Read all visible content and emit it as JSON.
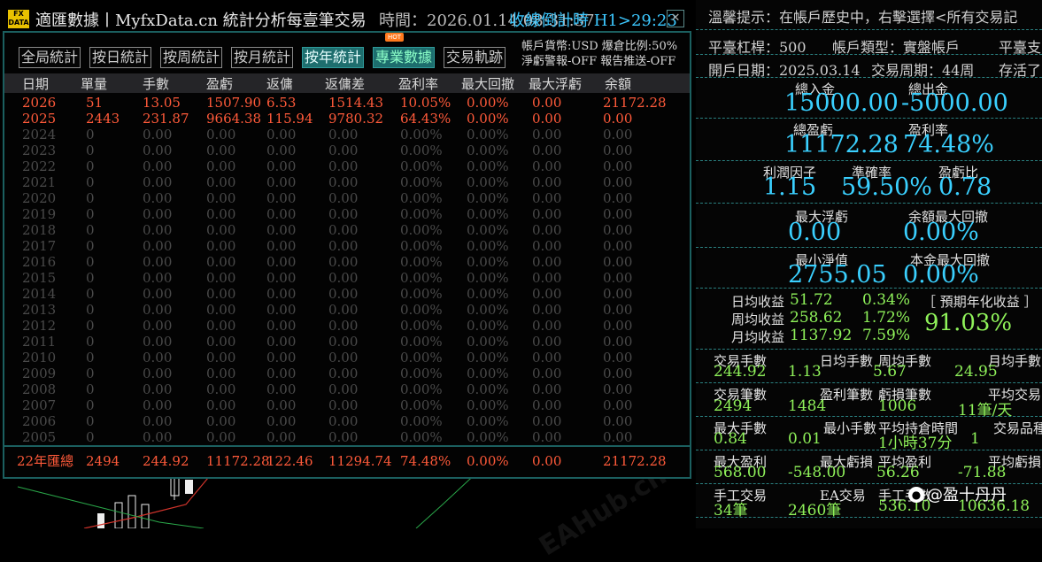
{
  "title_bar": {
    "logo_top": "FX",
    "logo_bottom": "DATA",
    "app_title": "適匯數據丨MyfxData.cn  統計分析每壹筆交易",
    "time_label": "時間：2026.01.14 08:31:37",
    "countdown_label": "收線倒計時  H1>29:23",
    "close_glyph": "✕"
  },
  "tabs": [
    {
      "label": "全局統計"
    },
    {
      "label": "按日統計"
    },
    {
      "label": "按周統計"
    },
    {
      "label": "按月統計"
    },
    {
      "label": "按年統計"
    },
    {
      "label": "專業數據"
    },
    {
      "label": "交易軌跡"
    }
  ],
  "hot_badge": "HOT",
  "account_info": {
    "line1": "帳戶貨幣:USD 爆倉比例:50%",
    "line2": "淨虧警報-OFF 報告推送-OFF"
  },
  "columns": [
    "日期",
    "單量",
    "手數",
    "盈虧",
    "返傭",
    "返傭差",
    "盈利率",
    "最大回撤",
    "最大浮虧",
    "余額"
  ],
  "rows": [
    [
      "2026",
      "51",
      "13.05",
      "1507.90",
      "6.53",
      "1514.43",
      "10.05%",
      "0.00%",
      "0.00",
      "21172.28"
    ],
    [
      "2025",
      "2443",
      "231.87",
      "9664.38",
      "115.94",
      "9780.32",
      "64.43%",
      "0.00%",
      "0.00",
      "0.00"
    ],
    [
      "2024",
      "0",
      "0.00",
      "0.00",
      "0.00",
      "0.00",
      "0.00%",
      "0.00%",
      "0.00",
      "0.00"
    ],
    [
      "2023",
      "0",
      "0.00",
      "0.00",
      "0.00",
      "0.00",
      "0.00%",
      "0.00%",
      "0.00",
      "0.00"
    ],
    [
      "2022",
      "0",
      "0.00",
      "0.00",
      "0.00",
      "0.00",
      "0.00%",
      "0.00%",
      "0.00",
      "0.00"
    ],
    [
      "2021",
      "0",
      "0.00",
      "0.00",
      "0.00",
      "0.00",
      "0.00%",
      "0.00%",
      "0.00",
      "0.00"
    ],
    [
      "2020",
      "0",
      "0.00",
      "0.00",
      "0.00",
      "0.00",
      "0.00%",
      "0.00%",
      "0.00",
      "0.00"
    ],
    [
      "2019",
      "0",
      "0.00",
      "0.00",
      "0.00",
      "0.00",
      "0.00%",
      "0.00%",
      "0.00",
      "0.00"
    ],
    [
      "2018",
      "0",
      "0.00",
      "0.00",
      "0.00",
      "0.00",
      "0.00%",
      "0.00%",
      "0.00",
      "0.00"
    ],
    [
      "2017",
      "0",
      "0.00",
      "0.00",
      "0.00",
      "0.00",
      "0.00%",
      "0.00%",
      "0.00",
      "0.00"
    ],
    [
      "2016",
      "0",
      "0.00",
      "0.00",
      "0.00",
      "0.00",
      "0.00%",
      "0.00%",
      "0.00",
      "0.00"
    ],
    [
      "2015",
      "0",
      "0.00",
      "0.00",
      "0.00",
      "0.00",
      "0.00%",
      "0.00%",
      "0.00",
      "0.00"
    ],
    [
      "2014",
      "0",
      "0.00",
      "0.00",
      "0.00",
      "0.00",
      "0.00%",
      "0.00%",
      "0.00",
      "0.00"
    ],
    [
      "2013",
      "0",
      "0.00",
      "0.00",
      "0.00",
      "0.00",
      "0.00%",
      "0.00%",
      "0.00",
      "0.00"
    ],
    [
      "2012",
      "0",
      "0.00",
      "0.00",
      "0.00",
      "0.00",
      "0.00%",
      "0.00%",
      "0.00",
      "0.00"
    ],
    [
      "2011",
      "0",
      "0.00",
      "0.00",
      "0.00",
      "0.00",
      "0.00%",
      "0.00%",
      "0.00",
      "0.00"
    ],
    [
      "2010",
      "0",
      "0.00",
      "0.00",
      "0.00",
      "0.00",
      "0.00%",
      "0.00%",
      "0.00",
      "0.00"
    ],
    [
      "2009",
      "0",
      "0.00",
      "0.00",
      "0.00",
      "0.00",
      "0.00%",
      "0.00%",
      "0.00",
      "0.00"
    ],
    [
      "2008",
      "0",
      "0.00",
      "0.00",
      "0.00",
      "0.00",
      "0.00%",
      "0.00%",
      "0.00",
      "0.00"
    ],
    [
      "2007",
      "0",
      "0.00",
      "0.00",
      "0.00",
      "0.00",
      "0.00%",
      "0.00%",
      "0.00",
      "0.00"
    ],
    [
      "2006",
      "0",
      "0.00",
      "0.00",
      "0.00",
      "0.00",
      "0.00%",
      "0.00%",
      "0.00",
      "0.00"
    ],
    [
      "2005",
      "0",
      "0.00",
      "0.00",
      "0.00",
      "0.00",
      "0.00%",
      "0.00%",
      "0.00",
      "0.00"
    ]
  ],
  "total_row": [
    "22年匯總",
    "2494",
    "244.92",
    "11172.28",
    "122.46",
    "11294.74",
    "74.48%",
    "0.00%",
    "0.00",
    "21172.28"
  ],
  "right": {
    "notice": "溫馨提示：在帳戶歷史中，右擊選擇<所有交易記",
    "leverage": "平臺杠桿：500",
    "account_type": "帳戶類型：實盤帳戶",
    "platform_cut": "平臺支",
    "open_date": "開戶日期：2025.03.14",
    "trade_period": "交易周期：44周",
    "survival_cut": "存活了",
    "deposit_label": "總入金",
    "deposit_value": "15000.00",
    "withdraw_label": "總出金",
    "withdraw_value": "-5000.00",
    "pnl_label": "總盈虧",
    "pnl_value": "11172.28",
    "profit_rate_label": "盈利率",
    "profit_rate_value": "74.48%",
    "profit_factor_label": "利潤因子",
    "profit_factor_value": "1.15",
    "accuracy_label": "準確率",
    "accuracy_value": "59.50%",
    "pl_ratio_label": "盈虧比",
    "pl_ratio_value": "0.78",
    "max_float_loss_label": "最大浮虧",
    "max_float_loss_value": "0.00",
    "balance_dd_label": "余額最大回撤",
    "balance_dd_value": "0.00%",
    "min_equity_label": "最小淨值",
    "min_equity_value": "2755.05",
    "capital_dd_label": "本金最大回撤",
    "capital_dd_value": "0.00%",
    "daily_label": "日均收益",
    "daily_value": "51.72",
    "daily_pct": "0.34%",
    "weekly_label": "周均收益",
    "weekly_value": "258.62",
    "weekly_pct": "1.72%",
    "monthly_label": "月均收益",
    "monthly_value": "1137.92",
    "monthly_pct": "7.59%",
    "annual_label": "［ 預期年化收益 ］",
    "annual_value": "91.03%",
    "lots_label": "交易手數",
    "lots_value": "244.92",
    "daily_lots_label": "日均手數",
    "daily_lots_value": "1.13",
    "weekly_lots_label": "周均手數",
    "weekly_lots_value": "5.67",
    "monthly_lots_label": "月均手數",
    "monthly_lots_value": "24.95",
    "trades_label": "交易筆數",
    "trades_value": "2494",
    "win_trades_label": "盈利筆數",
    "win_trades_value": "1484",
    "loss_trades_label": "虧損筆數",
    "loss_trades_value": "1006",
    "avg_trades_label": "平均交易",
    "avg_trades_value": "11筆/天",
    "max_lots_label": "最大手數",
    "max_lots_value": "0.84",
    "min_lots_label": "最小手數",
    "min_lots_value": "0.01",
    "avg_hold_label": "平均持倉時間",
    "avg_hold_value": "1小時37分",
    "symbols_label": "交易品種",
    "symbols_value": "1",
    "max_profit_label": "最大盈利",
    "max_profit_value": "568.00",
    "max_loss_label": "最大虧損",
    "max_loss_value": "-548.00",
    "avg_profit_label": "平均盈利",
    "avg_profit_value": "56.26",
    "avg_loss_label": "平均虧損",
    "avg_loss_value": "-71.88",
    "manual_label": "手工交易",
    "manual_value": "34筆",
    "ea_label": "EA交易",
    "ea_value": "2460筆",
    "manual_lots_label": "手工手數",
    "manual_lots_value": "536.10",
    "ea_lots_value": "10636.18"
  },
  "watermark_text": "EAHub.cn",
  "weibo_text": "@盈十丹丹",
  "colors": {
    "positive": "#ff5a3a",
    "inactive": "#4a4a4a",
    "accent_cyan": "#3ad0ff",
    "accent_green": "#8ff25a",
    "frame_teal": "#1b5f5f"
  }
}
